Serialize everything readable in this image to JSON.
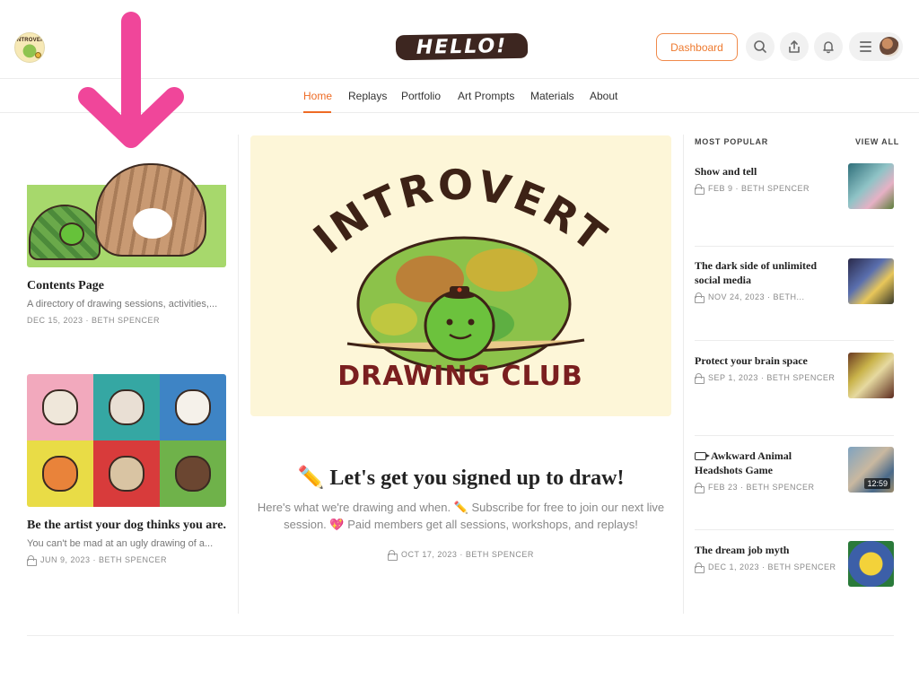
{
  "header": {
    "logo_icon": "introvert-drawing-club-logo",
    "site_title": "HELLO!",
    "dashboard_label": "Dashboard",
    "icons": [
      "search-icon",
      "share-icon",
      "bell-icon",
      "menu-icon",
      "avatar"
    ]
  },
  "nav": {
    "items": [
      "Home",
      "Replays",
      "Portfolio",
      "Art Prompts",
      "Materials",
      "About"
    ],
    "active": "Home",
    "accent_color": "#ee6b25"
  },
  "annotation": {
    "icon": "arrow-down-icon",
    "color": "#f0469a"
  },
  "left_posts": [
    {
      "title": "Contents Page",
      "subtitle": "A directory of drawing sessions, activities,...",
      "meta": "DEC 15, 2023 · BETH SPENCER",
      "locked": false
    },
    {
      "title": "Be the artist your dog thinks you are.",
      "subtitle": "You can't be mad at an ugly drawing of a...",
      "meta": "JUN 9, 2023 · BETH SPENCER",
      "locked": true
    }
  ],
  "hero": {
    "logo_top": "INTROVERT",
    "logo_bottom": "DRAWING CLUB",
    "title": "✏️ Let's get you signed up to draw!",
    "body": "Here's what we're drawing and when. ✏️ Subscribe for free to join our next live session. 💖 Paid members get all sessions, workshops, and replays!",
    "meta": "OCT 17, 2023 · BETH SPENCER"
  },
  "sidebar": {
    "heading": "MOST POPULAR",
    "view_all": "VIEW ALL",
    "items": [
      {
        "title": "Show and tell",
        "meta": "FEB 9 · BETH SPENCER",
        "video": false,
        "duration": ""
      },
      {
        "title": "The dark side of unlimited social media",
        "meta": "NOV 24, 2023 · BETH...",
        "video": false,
        "duration": ""
      },
      {
        "title": "Protect your brain space",
        "meta": "SEP 1, 2023 · BETH SPENCER",
        "video": false,
        "duration": ""
      },
      {
        "title": "Awkward Animal Headshots Game",
        "meta": "FEB 23 · BETH SPENCER",
        "video": true,
        "duration": "12:59"
      },
      {
        "title": "The dream job myth",
        "meta": "DEC 1, 2023 · BETH SPENCER",
        "video": false,
        "duration": ""
      }
    ]
  }
}
